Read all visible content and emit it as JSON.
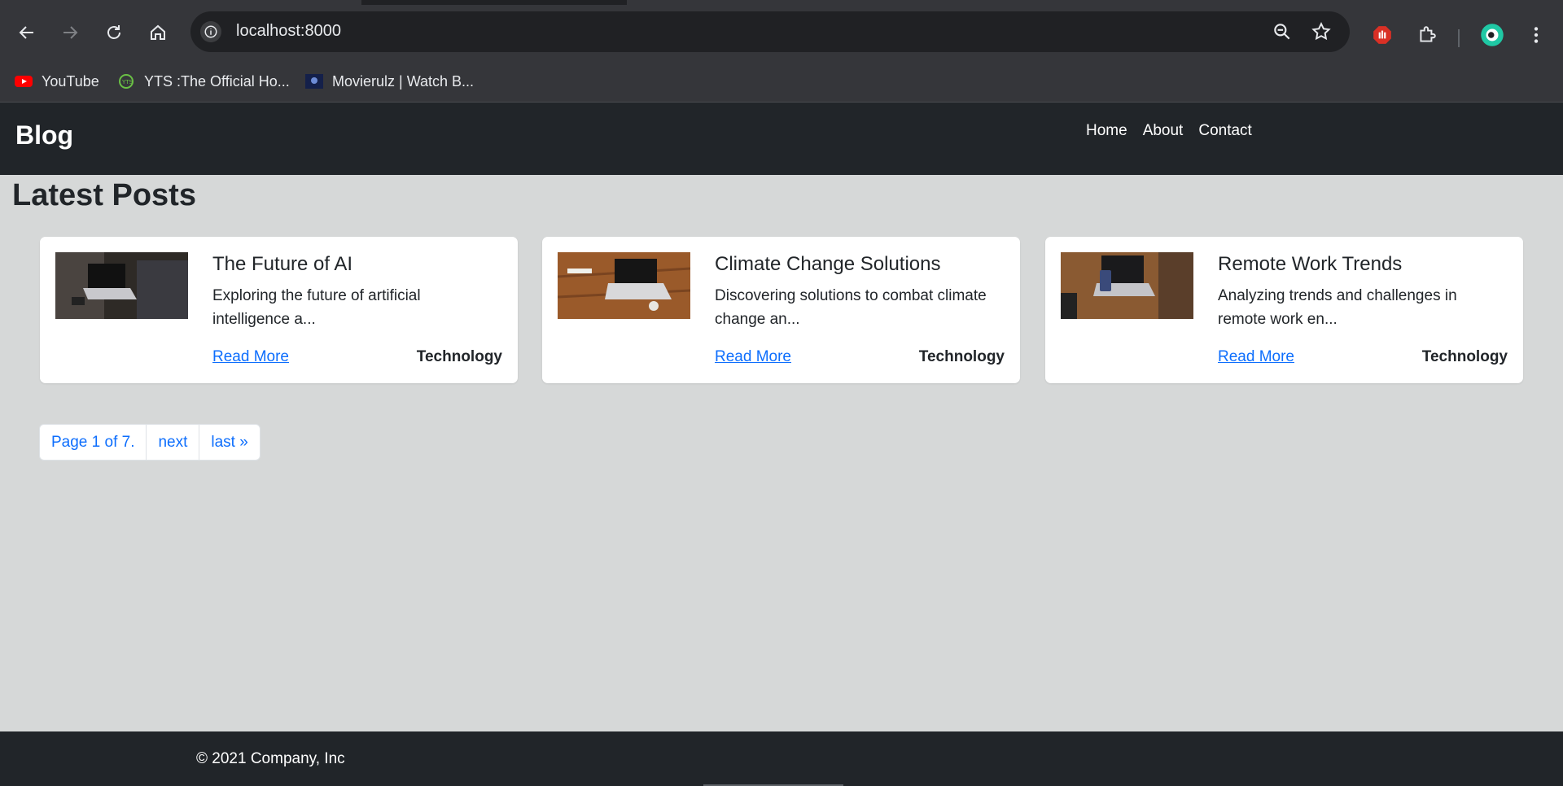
{
  "browser": {
    "url": "localhost:8000",
    "bookmarks": [
      {
        "label": "YouTube",
        "icon": "youtube-icon"
      },
      {
        "label": "YTS :The Official Ho...",
        "icon": "yts-icon"
      },
      {
        "label": "Movierulz | Watch B...",
        "icon": "movierulz-icon"
      }
    ]
  },
  "site": {
    "brand": "Blog",
    "nav": [
      "Home",
      "About",
      "Contact"
    ]
  },
  "main": {
    "title": "Latest Posts",
    "posts": [
      {
        "title": "The Future of AI",
        "excerpt": "Exploring the future of artificial intelligence a...",
        "read_more": "Read More",
        "category": "Technology"
      },
      {
        "title": "Climate Change Solutions",
        "excerpt": "Discovering solutions to combat climate change an...",
        "read_more": "Read More",
        "category": "Technology"
      },
      {
        "title": "Remote Work Trends",
        "excerpt": "Analyzing trends and challenges in remote work en...",
        "read_more": "Read More",
        "category": "Technology"
      }
    ],
    "pagination": {
      "status": "Page 1 of 7.",
      "next": "next",
      "last": "last »"
    }
  },
  "footer": {
    "copyright": "© 2021 Company, Inc"
  },
  "colors": {
    "page_bg": "#d6d8d8",
    "header_bg": "#212529",
    "link": "#0d6efd",
    "chrome_bg": "#35363a"
  }
}
